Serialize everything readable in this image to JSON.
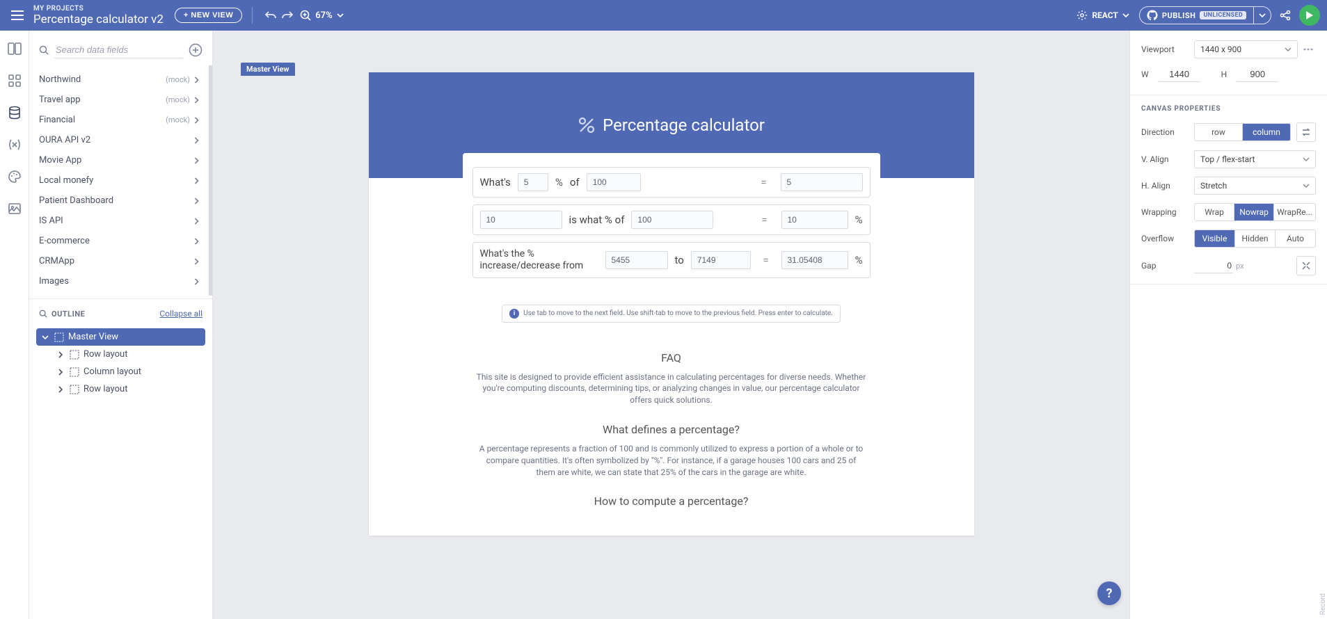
{
  "topbar": {
    "breadcrumb_top": "MY PROJECTS",
    "breadcrumb_title": "Percentage calculator v2",
    "new_view": "+ NEW VIEW",
    "zoom": "67%",
    "framework": "REACT",
    "publish": "PUBLISH",
    "publish_badge": "UNLICENSED"
  },
  "sidebar": {
    "search_placeholder": "Search data fields",
    "datasources": [
      {
        "name": "Northwind",
        "mock": "(mock)"
      },
      {
        "name": "Travel app",
        "mock": "(mock)"
      },
      {
        "name": "Financial",
        "mock": "(mock)"
      },
      {
        "name": "OURA API v2",
        "mock": ""
      },
      {
        "name": "Movie App",
        "mock": ""
      },
      {
        "name": "Local monefy",
        "mock": ""
      },
      {
        "name": "Patient Dashboard",
        "mock": ""
      },
      {
        "name": "IS API",
        "mock": ""
      },
      {
        "name": "E-commerce",
        "mock": ""
      },
      {
        "name": "CRMApp",
        "mock": ""
      },
      {
        "name": "Images",
        "mock": ""
      }
    ],
    "outline_title": "OUTLINE",
    "collapse_all": "Collapse all",
    "tree": [
      {
        "label": "Master View",
        "active": true,
        "child": false,
        "open": true
      },
      {
        "label": "Row layout",
        "active": false,
        "child": true,
        "open": false
      },
      {
        "label": "Column layout",
        "active": false,
        "child": true,
        "open": false
      },
      {
        "label": "Row layout",
        "active": false,
        "child": true,
        "open": false
      }
    ]
  },
  "canvas": {
    "view_label": "Master View",
    "app_title": "Percentage calculator",
    "row1": {
      "label1": "What's",
      "val1": "5",
      "label2": "of",
      "val2": "100",
      "result": "5"
    },
    "row2": {
      "val1": "10",
      "label": "is what % of",
      "val2": "100",
      "result": "10"
    },
    "row3": {
      "label1": "What's the % increase/decrease from",
      "val1": "5455",
      "label2": "to",
      "val2": "7149",
      "result": "31.05408"
    },
    "hint": "Use tab to move to the next field. Use shift-tab to move to the previous field. Press enter to calculate.",
    "faq": {
      "h1": "FAQ",
      "p1": "This site is designed to provide efficient assistance in calculating percentages for diverse needs. Whether you're computing discounts, determining tips, or analyzing changes in value, our percentage calculator offers quick solutions.",
      "h2": "What defines a percentage?",
      "p2": "A percentage represents a fraction of 100 and is commonly utilized to express a portion of a whole or to compare quantities. It's often symbolized by \"%\". For instance, if a garage houses 100 cars and 25 of them are white, we can state that 25% of the cars in the garage are white.",
      "h3": "How to compute a percentage?"
    }
  },
  "props": {
    "viewport_label": "Viewport",
    "viewport_value": "1440 x 900",
    "w_label": "W",
    "w_value": "1440",
    "h_label": "H",
    "h_value": "900",
    "section_title": "CANVAS PROPERTIES",
    "direction_label": "Direction",
    "direction_row": "row",
    "direction_column": "column",
    "valign_label": "V. Align",
    "valign_value": "Top / flex-start",
    "halign_label": "H. Align",
    "halign_value": "Stretch",
    "wrapping_label": "Wrapping",
    "wrap": "Wrap",
    "nowrap": "Nowrap",
    "wrapre": "WrapRe...",
    "overflow_label": "Overflow",
    "visible": "Visible",
    "hidden": "Hidden",
    "auto": "Auto",
    "gap_label": "Gap",
    "gap_value": "0",
    "gap_unit": "px"
  },
  "help": "?",
  "record": "Record"
}
